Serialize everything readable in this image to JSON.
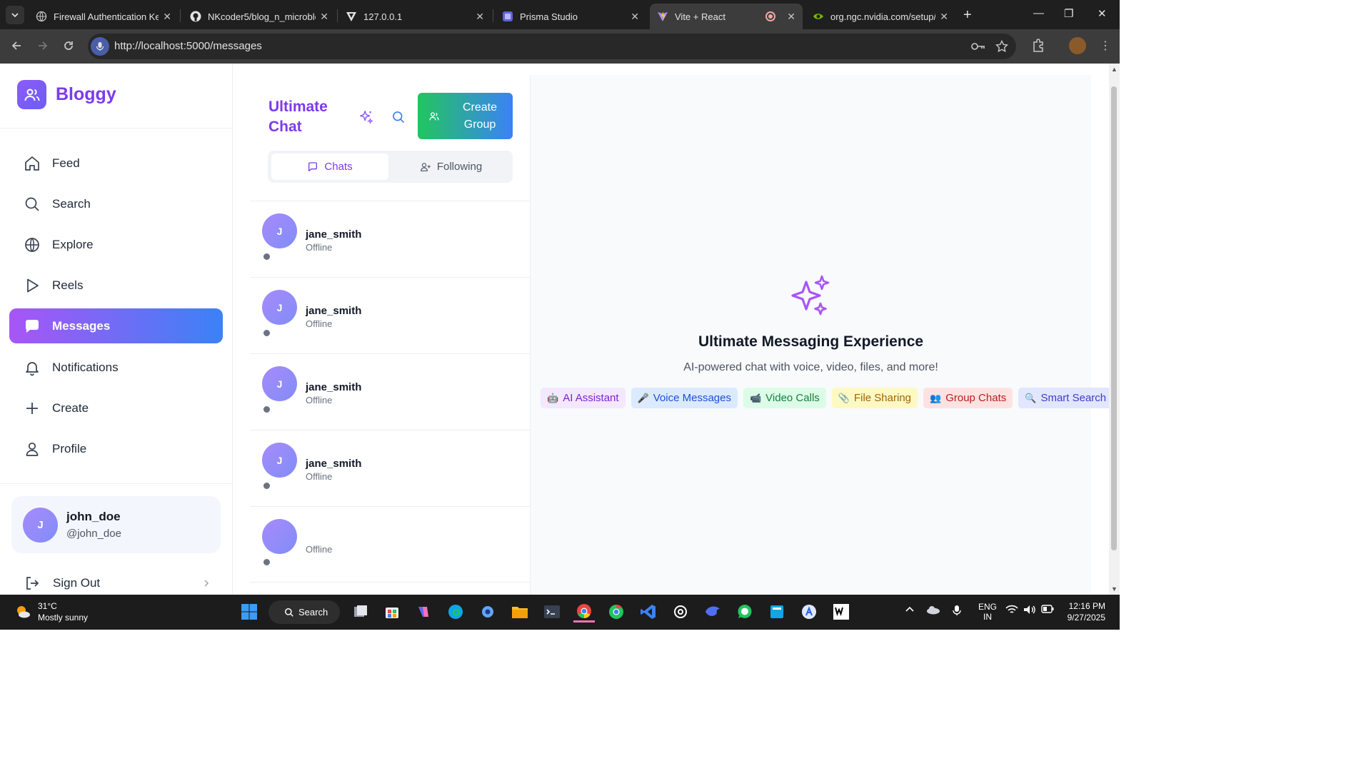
{
  "browser": {
    "tabs": [
      {
        "title": "Firewall Authentication Ke",
        "icon": "globe-icon"
      },
      {
        "title": "NKcoder5/blog_n_microblo",
        "icon": "github-icon"
      },
      {
        "title": "127.0.0.1",
        "icon": "vercel-icon"
      },
      {
        "title": "Prisma Studio",
        "icon": "prisma-icon"
      },
      {
        "title": "Vite + React",
        "icon": "vite-icon",
        "active": true
      },
      {
        "title": "org.ngc.nvidia.com/setup/",
        "icon": "nvidia-icon"
      }
    ],
    "url": "http://localhost:5000/messages"
  },
  "sidebar": {
    "brand": "Bloggy",
    "nav": [
      {
        "label": "Feed",
        "icon": "home-icon"
      },
      {
        "label": "Search",
        "icon": "search-icon"
      },
      {
        "label": "Explore",
        "icon": "globe-icon"
      },
      {
        "label": "Reels",
        "icon": "play-icon"
      },
      {
        "label": "Messages",
        "icon": "message-icon",
        "active": true
      },
      {
        "label": "Notifications",
        "icon": "bell-icon"
      },
      {
        "label": "Create",
        "icon": "plus-icon"
      },
      {
        "label": "Profile",
        "icon": "user-icon"
      }
    ],
    "user": {
      "initial": "J",
      "name": "john_doe",
      "handle": "@john_doe"
    },
    "sign_out": "Sign Out"
  },
  "chat": {
    "title": "Ultimate Chat",
    "create_group": "Create Group",
    "tabs": {
      "chats": "Chats",
      "following": "Following"
    },
    "conversations": [
      {
        "initial": "J",
        "name": "jane_smith",
        "status": "Offline"
      },
      {
        "initial": "J",
        "name": "jane_smith",
        "status": "Offline"
      },
      {
        "initial": "J",
        "name": "jane_smith",
        "status": "Offline"
      },
      {
        "initial": "J",
        "name": "jane_smith",
        "status": "Offline"
      },
      {
        "initial": "",
        "name": "",
        "status": "Offline"
      }
    ]
  },
  "main": {
    "title": "Ultimate Messaging Experience",
    "subtitle": "AI-powered chat with voice, video, files, and more!",
    "features": [
      {
        "emoji": "🤖",
        "label": "AI Assistant",
        "bg": "#f3e8ff",
        "color": "#7e22ce"
      },
      {
        "emoji": "🎤",
        "label": "Voice Messages",
        "bg": "#dbeafe",
        "color": "#1d4ed8"
      },
      {
        "emoji": "📹",
        "label": "Video Calls",
        "bg": "#dcfce7",
        "color": "#15803d"
      },
      {
        "emoji": "📎",
        "label": "File Sharing",
        "bg": "#fef9c3",
        "color": "#a16207"
      },
      {
        "emoji": "👥",
        "label": "Group Chats",
        "bg": "#fee2e2",
        "color": "#b91c1c"
      },
      {
        "emoji": "🔍",
        "label": "Smart Search",
        "bg": "#e0e7ff",
        "color": "#4338ca"
      }
    ]
  },
  "taskbar": {
    "weather": {
      "temp": "31°C",
      "desc": "Mostly sunny"
    },
    "search_label": "Search",
    "lang": {
      "line1": "ENG",
      "line2": "IN"
    },
    "time": "12:16 PM",
    "date": "9/27/2025"
  },
  "colors": {
    "accent": "#7c3aed",
    "gradient_start": "#a855f7",
    "gradient_end": "#3b82f6"
  }
}
